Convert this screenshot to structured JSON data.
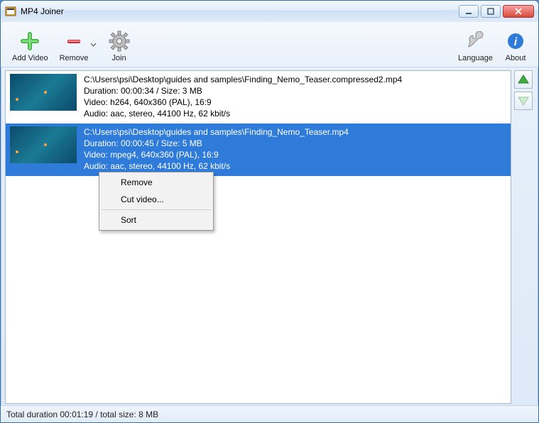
{
  "window": {
    "title": "MP4 Joiner"
  },
  "toolbar": {
    "add_video": "Add Video",
    "remove": "Remove",
    "join": "Join",
    "language": "Language",
    "about": "About"
  },
  "items": [
    {
      "selected": false,
      "path": "C:\\Users\\psi\\Desktop\\guides and samples\\Finding_Nemo_Teaser.compressed2.mp4",
      "duration_size": "Duration: 00:00:34 / Size: 3 MB",
      "video": "Video: h264, 640x360 (PAL), 16:9",
      "audio": "Audio: aac, stereo, 44100 Hz, 62 kbit/s"
    },
    {
      "selected": true,
      "path": "C:\\Users\\psi\\Desktop\\guides and samples\\Finding_Nemo_Teaser.mp4",
      "duration_size": "Duration: 00:00:45 / Size: 5 MB",
      "video": "Video: mpeg4, 640x360 (PAL), 16:9",
      "audio": "Audio: aac, stereo, 44100 Hz, 62 kbit/s"
    }
  ],
  "context_menu": {
    "remove": "Remove",
    "cut": "Cut video...",
    "sort": "Sort"
  },
  "status": "Total duration 00:01:19 / total size: 8 MB"
}
